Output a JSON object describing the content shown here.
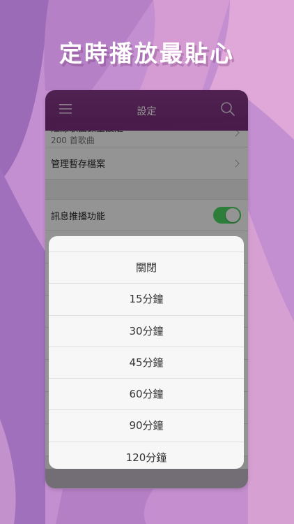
{
  "headline": "定時播放最貼心",
  "nav": {
    "title": "設定",
    "menu_icon": "hamburger-menu-icon",
    "search_icon": "search-icon"
  },
  "settings": {
    "rows": [
      {
        "title": "離線歌曲數量設定",
        "subtitle": "200 首歌曲"
      },
      {
        "title": "管理暫存檔案"
      },
      {
        "title": "訊息推播功能",
        "toggle_on": true
      }
    ]
  },
  "timer_sheet": {
    "options": [
      "關閉",
      "15分鐘",
      "30分鐘",
      "45分鐘",
      "60分鐘",
      "90分鐘",
      "120分鐘"
    ]
  },
  "colors": {
    "nav_purple": "#7c2f80",
    "toggle_green": "#4cd964",
    "background": "#b57fc4"
  }
}
